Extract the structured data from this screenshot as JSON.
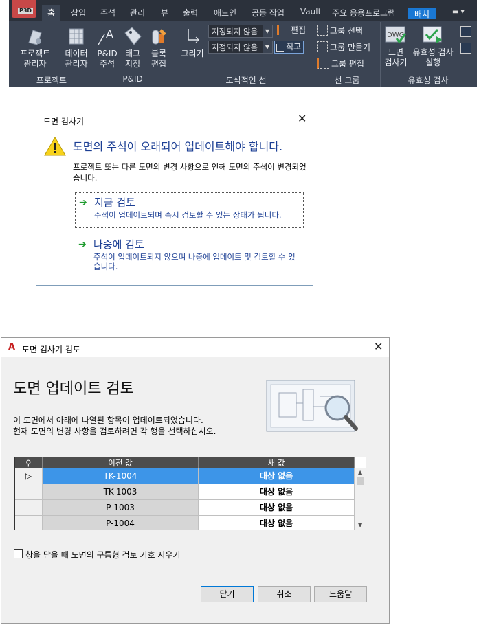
{
  "ribbon": {
    "app_label": "P3D",
    "tabs": [
      "홈",
      "삽입",
      "주석",
      "관리",
      "뷰",
      "출력",
      "애드인",
      "공동 작업",
      "Vault",
      "주요 응용프로그램"
    ],
    "layout_tab": "배치",
    "buttons": {
      "project_manager": [
        "프로젝트",
        "관리자"
      ],
      "data_manager": [
        "데이터",
        "관리자"
      ],
      "pid_annotation": [
        "P&ID",
        "주석"
      ],
      "tag_assign": [
        "태그",
        "지정"
      ],
      "block_edit": [
        "블록",
        "편집"
      ],
      "draw": "그리기",
      "edit": "편집",
      "ortho": "직교",
      "group_select": "그룹 선택",
      "group_make": "그룹 만들기",
      "group_edit": "그룹 편집",
      "drawing_checker": [
        "도면",
        "검사기"
      ],
      "validation_run": [
        "유효성 검사",
        "실행"
      ]
    },
    "combos": [
      "지정되지 않음",
      "지정되지 않음"
    ],
    "dwg_label": "DWG",
    "panels": [
      "프로젝트",
      "P&ID",
      "도식적인 선",
      "선 그룹",
      "유효성 검사"
    ]
  },
  "dialog1": {
    "title": "도면 검사기",
    "main_instruction": "도면의 주석이 오래되어 업데이트해야 합니다.",
    "content": "프로젝트 또는 다른 도면의 변경 사항으로 인해 도면의 주석이 변경되었습니다.",
    "options": [
      {
        "title": "지금 검토",
        "desc": "주석이 업데이트되며 즉시 검토할 수 있는 상태가 됩니다."
      },
      {
        "title": "나중에 검토",
        "desc": "주석이 업데이트되지 않으며 나중에 업데이트 및 검토할 수 있습니다."
      }
    ]
  },
  "dialog2": {
    "title": "도면 검사기 검토",
    "heading": "도면 업데이트 검토",
    "desc_line1": "이 도면에서 아래에 나열된 항목이 업데이트되었습니다.",
    "desc_line2": "현재 도면의 변경 사항을 검토하려면 각 행을 선택하십시오.",
    "columns": [
      "이전 값",
      "새 값"
    ],
    "rows": [
      {
        "old": "TK-1004",
        "new": "대상 없음"
      },
      {
        "old": "TK-1003",
        "new": "대상 없음"
      },
      {
        "old": "P-1003",
        "new": "대상 없음"
      },
      {
        "old": "P-1004",
        "new": "대상 없음"
      }
    ],
    "checkbox_label": "창을 닫을 때 도면의 구름형 검토 기호 지우기",
    "buttons": {
      "close": "닫기",
      "cancel": "취소",
      "help": "도움말"
    }
  }
}
